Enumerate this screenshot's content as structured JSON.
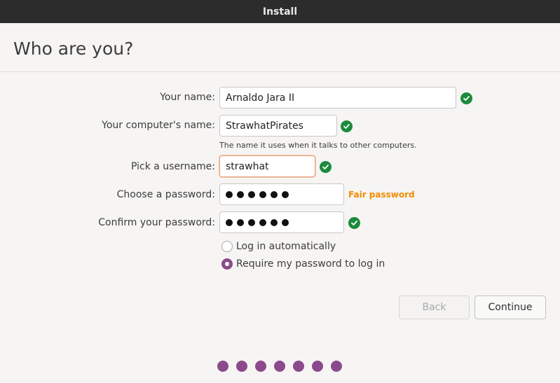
{
  "window": {
    "title": "Install"
  },
  "page": {
    "title": "Who are you?"
  },
  "form": {
    "name": {
      "label": "Your name:",
      "value": "Arnaldo Jara II"
    },
    "computer": {
      "label": "Your computer's name:",
      "value": "StrawhatPirates",
      "hint": "The name it uses when it talks to other computers."
    },
    "username": {
      "label": "Pick a username:",
      "value": "strawhat"
    },
    "password": {
      "label": "Choose a password:",
      "masked_length": 6,
      "strength": "Fair password"
    },
    "confirm": {
      "label": "Confirm your password:",
      "masked_length": 6
    },
    "login_options": [
      {
        "label": "Log in automatically",
        "selected": false
      },
      {
        "label": "Require my password to log in",
        "selected": true
      }
    ]
  },
  "buttons": {
    "back": "Back",
    "continue": "Continue"
  },
  "progress": {
    "total_steps": 7
  },
  "colors": {
    "accent": "#8b4a8b",
    "check": "#1b8a3c",
    "strength": "#f08c00",
    "titlebar": "#2c2c2c"
  },
  "icons": {
    "valid": "check-circle-icon"
  }
}
